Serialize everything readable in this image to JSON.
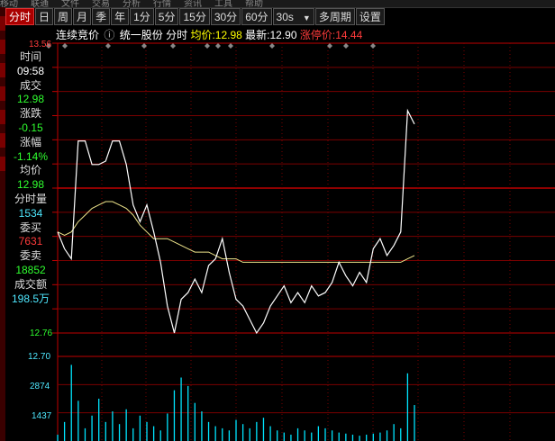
{
  "top_menu": [
    "移动",
    "联通",
    "文件",
    "交易",
    "分析",
    "行情",
    "资讯",
    "工具",
    "帮助"
  ],
  "toolbar": {
    "tabs": [
      {
        "label": "分时",
        "active": true
      },
      {
        "label": "日",
        "active": false
      },
      {
        "label": "周",
        "active": false
      },
      {
        "label": "月",
        "active": false
      },
      {
        "label": "季",
        "active": false
      },
      {
        "label": "年",
        "active": false
      },
      {
        "label": "1分",
        "active": false
      },
      {
        "label": "5分",
        "active": false
      },
      {
        "label": "15分",
        "active": false
      },
      {
        "label": "30分",
        "active": false
      },
      {
        "label": "60分",
        "active": false
      }
    ],
    "period_select": "30s",
    "multi_period": "多周期",
    "settings": "设置"
  },
  "info": {
    "mode": "连续竞价",
    "stock_name": "统一股份",
    "chart_kind": "分时",
    "avg_label": "均价:",
    "avg_value": "12.98",
    "latest_label": "最新:",
    "latest_value": "12.90",
    "limit_label": "涨停价:",
    "limit_value": "14.44"
  },
  "panel": {
    "time_label": "时间",
    "time_value": "09:58",
    "volume_label": "成交",
    "volume_value": "12.98",
    "change_label": "涨跌",
    "change_value": "-0.15",
    "pct_label": "涨幅",
    "pct_value": "-1.14%",
    "avg_label": "均价",
    "avg_value": "12.98",
    "tick_vol_label": "分时量",
    "tick_vol_value": "1534",
    "buy_label": "委买",
    "buy_value": "7631",
    "sell_label": "委卖",
    "sell_value": "18852",
    "amount_label": "成交额",
    "amount_value": "198.5万"
  },
  "axis_labels": {
    "price_top": "13.56",
    "price_bottom": "12.76",
    "vol_base": "12.70",
    "vol_mid": "2874",
    "vol_low": "1437"
  },
  "colors": {
    "price_line": "#ffffff",
    "avg_line": "#f0e68c",
    "volume": "#00e5ff",
    "grid": "#7a0000",
    "grid_strong": "#c00000",
    "up": "#ff3b3b",
    "down": "#2fff2f"
  },
  "chart_data": {
    "type": "line",
    "series": [
      {
        "values": [
          13.0,
          12.95,
          12.92,
          13.27,
          13.27,
          13.2,
          13.2,
          13.21,
          13.27,
          13.27,
          13.2,
          13.08,
          13.03,
          13.08,
          13.0,
          12.91,
          12.78,
          12.7,
          12.8,
          12.82,
          12.86,
          12.82,
          12.9,
          12.92,
          12.98,
          12.88,
          12.8,
          12.78,
          12.74,
          12.7,
          12.73,
          12.78,
          12.81,
          12.84,
          12.79,
          12.82,
          12.79,
          12.84,
          12.81,
          12.82,
          12.85,
          12.91,
          12.87,
          12.84,
          12.88,
          12.85,
          12.95,
          12.98,
          12.93,
          12.96,
          13.0,
          13.36,
          13.32
        ]
      },
      {
        "values": [
          13.0,
          12.99,
          13.0,
          13.03,
          13.05,
          13.07,
          13.08,
          13.09,
          13.09,
          13.08,
          13.07,
          13.05,
          13.02,
          13.0,
          12.98,
          12.98,
          12.98,
          12.97,
          12.96,
          12.95,
          12.94,
          12.94,
          12.94,
          12.93,
          12.92,
          12.92,
          12.92,
          12.91,
          12.91,
          12.91,
          12.91,
          12.91,
          12.91,
          12.91,
          12.91,
          12.91,
          12.91,
          12.91,
          12.91,
          12.91,
          12.91,
          12.91,
          12.91,
          12.91,
          12.91,
          12.91,
          12.91,
          12.91,
          12.91,
          12.91,
          12.91,
          12.92,
          12.93
        ]
      }
    ],
    "ylim": [
      12.7,
      13.56
    ],
    "volume": [
      300,
      900,
      3600,
      1900,
      600,
      1200,
      2000,
      900,
      1400,
      800,
      1500,
      600,
      1200,
      900,
      700,
      500,
      1300,
      2400,
      3000,
      2600,
      1800,
      1400,
      900,
      700,
      600,
      500,
      1000,
      800,
      600,
      900,
      1100,
      700,
      500,
      400,
      300,
      600,
      500,
      400,
      700,
      600,
      500,
      400,
      350,
      300,
      250,
      300,
      350,
      400,
      500,
      800,
      600,
      3200,
      1700
    ],
    "volume_ylim": [
      0,
      4000
    ]
  }
}
